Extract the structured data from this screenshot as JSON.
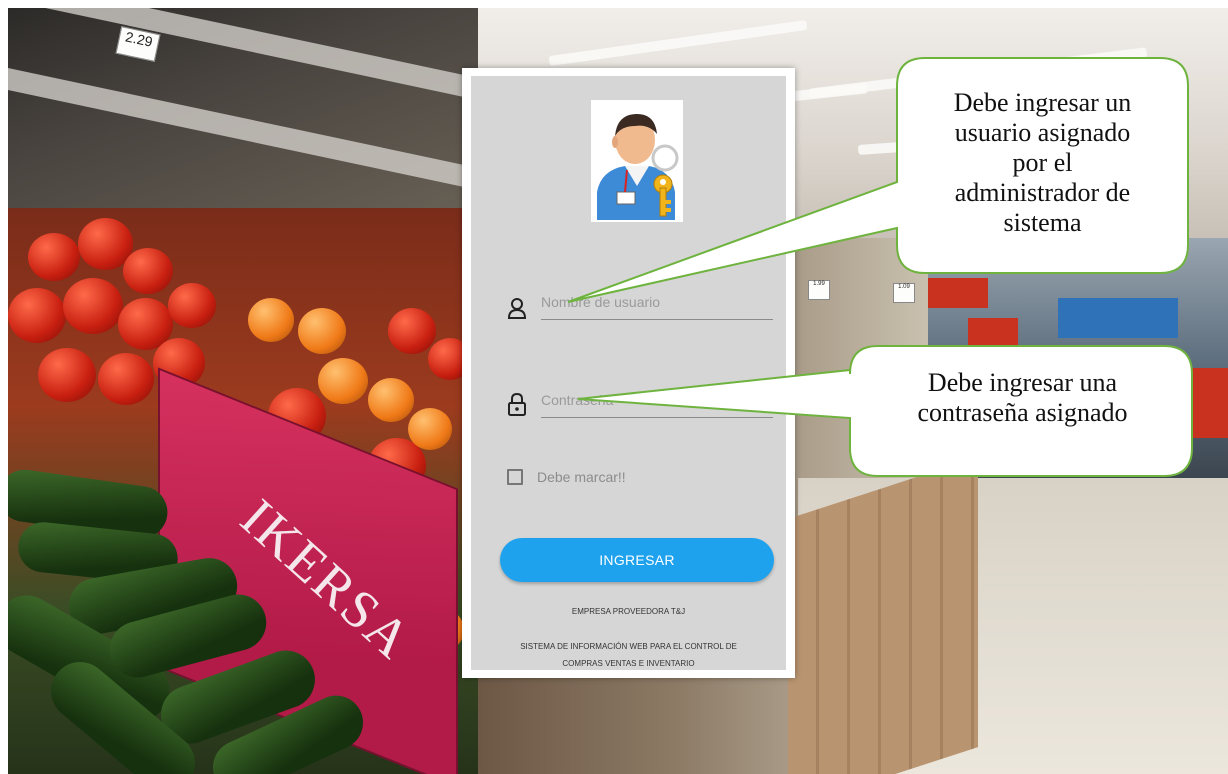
{
  "login_card": {
    "avatar_icon": "user-with-key-icon",
    "username": {
      "placeholder": "Nombre de usuario",
      "icon": "user-icon"
    },
    "password": {
      "placeholder": "Contraseña",
      "icon": "lock-icon"
    },
    "checkbox_label": "Debe marcar!!",
    "submit_label": "INGRESAR",
    "company_name": "EMPRESA PROVEEDORA T&J",
    "system_description_line1": "SISTEMA DE INFORMACIÓN WEB PARA EL CONTROL DE",
    "system_description_line2": "COMPRAS VENTAS E INVENTARIO"
  },
  "callouts": {
    "username_hint": [
      "Debe ingresar un",
      "usuario asignado",
      "por el",
      "administrador de",
      "sistema"
    ],
    "password_hint": [
      "Debe ingresar una",
      "contraseña asignado"
    ],
    "border_color": "#6fb33f"
  },
  "background": {
    "crate_brand": "IKERSA",
    "price_tags": [
      "1.99",
      "1.09",
      "2.29"
    ]
  }
}
